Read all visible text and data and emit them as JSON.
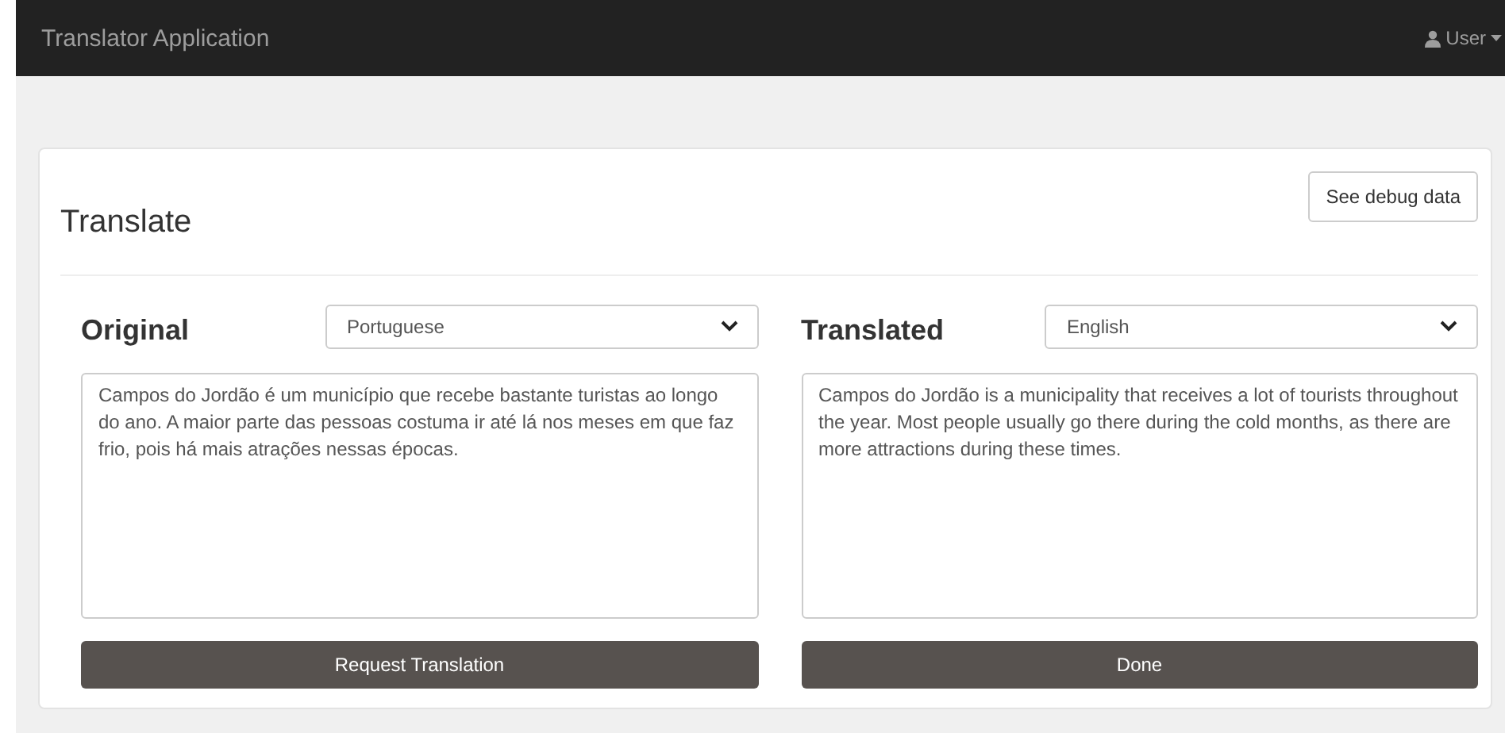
{
  "navbar": {
    "title": "Translator Application",
    "user_menu": "User"
  },
  "card": {
    "title": "Translate",
    "debug_button": "See debug data"
  },
  "panels": [
    {
      "heading": "Original",
      "language": "Portuguese",
      "text": "Campos do Jordão é um município que recebe bastante turistas ao longo do ano. A maior parte das pessoas costuma ir até lá nos meses em que faz frio, pois há mais atrações nessas épocas.",
      "button": "Request Translation"
    },
    {
      "heading": "Translated",
      "language": "English",
      "text": "Campos do Jordão is a municipality that receives a lot of tourists throughout the year. Most people usually go there during the cold months, as there are more attractions during these times.",
      "button": "Done"
    }
  ]
}
